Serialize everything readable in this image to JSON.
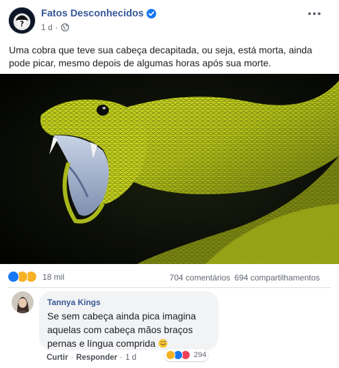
{
  "post": {
    "page_name": "Fatos Desconhecidos",
    "time": "1 d",
    "separator": "·",
    "text": "Uma cobra que teve sua cabeça decapitada, ou seja, está morta, ainda pode picar, mesmo depois de algumas horas após sua morte."
  },
  "stats": {
    "reactions_count": "18 mil",
    "comments": "704 comentários",
    "shares": "694 compartilhamentos"
  },
  "comment": {
    "author": "Tannya Kings",
    "text": "Se sem cabeça ainda pica imagina aquelas com cabeça mãos braços pernas e língua comprida",
    "reactions_count": "294",
    "like_label": "Curtir",
    "reply_label": "Responder",
    "time": "1 d",
    "sep": "·"
  },
  "colors": {
    "link": "#385898",
    "like": "#1877f2",
    "yellow": "#f7b125",
    "love": "#f33e58"
  },
  "icons": [
    "verified-badge-icon",
    "globe-icon",
    "more-options-icon",
    "like-reaction-icon",
    "wow-reaction-icon",
    "haha-reaction-icon",
    "love-reaction-icon",
    "sweat-smile-emoji"
  ]
}
